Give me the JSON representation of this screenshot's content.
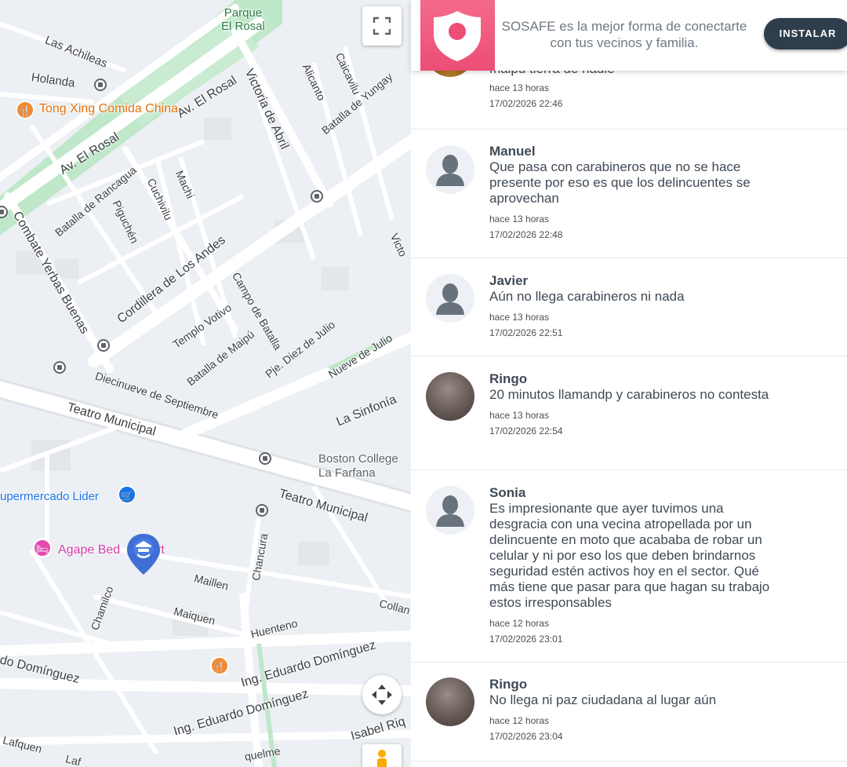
{
  "map": {
    "labels": {
      "parque": "Parque\nEl Rosal",
      "las_achileas": "Las Achileas",
      "holanda": "Holanda",
      "av_el_rosal_1": "Av. El Rosal",
      "av_el_rosal_2": "Av. El Rosal",
      "victoria_de_abril": "Victoria de Abril",
      "alicanto": "Alicanto",
      "caicavilu": "Caicavilu",
      "batalla_de_yungay": "Batalla de Yungay",
      "tong_xing": "Tong Xing Comida China",
      "batalla_de_rancagua": "Batalla de Rancagua",
      "piguchen": "Piguchén",
      "cuchivilu": "Cuchivilu",
      "machi": "Machi",
      "combate_yerbas_buenas": "Combate Yerbas Buenas",
      "cordillera_de_los_andes": "Cordillera de Los Andes",
      "templo_votivo": "Templo Votivo",
      "campo_de_batalla": "Campo de Batalla",
      "batalla_de_maipu": "Batalla de Maipú",
      "pje_diez_de_julio": "Pje. Diez de Julio",
      "nueve_de_julio": "Nueve de Julio",
      "diecinueve_de_septiembre": "Diecinueve de Septiembre",
      "teatro_municipal_1": "Teatro Municipal",
      "la_sinfonia": "La Sinfonía",
      "boston_college": "Boston College\nLa Farfana",
      "supermercado_lider": "upermercado Lider",
      "teatro_municipal_2": "Teatro Municipal",
      "agape": "Agape Bed",
      "agape_suffix": "rt",
      "chancura": "Chancura",
      "maillen": "Maillen",
      "chamilco": "Chamilco",
      "maiquen": "Maiquen",
      "collan": "Collan",
      "huenteno": "Huenteno",
      "do_dominguez": "do Domínguez",
      "ing_eduardo_1": "Ing. Eduardo Domínguez",
      "ing_eduardo_2": "Ing. Eduardo Domínguez",
      "isabel_riq": "Isabel Riq",
      "lafquen": "Lafquen",
      "laf": "Laf",
      "quelme": "quelme",
      "victo": "Victo"
    }
  },
  "banner": {
    "text": "SOSAFE es la mejor forma de conectarte con tus vecinos y familia.",
    "install_label": "INSTALAR"
  },
  "comments": [
    {
      "name": "",
      "text": "maipu tierra de nadie",
      "relative": "hace 13 horas",
      "date": "17/02/2026 22:46"
    },
    {
      "name": "Manuel",
      "text": "Que pasa con carabineros que no se hace presente por eso es que los delincuentes se aprovechan",
      "relative": "hace 13 horas",
      "date": "17/02/2026 22:48"
    },
    {
      "name": "Javier",
      "text": "Aún no llega carabineros ni nada",
      "relative": "hace 13 horas",
      "date": "17/02/2026 22:51"
    },
    {
      "name": "Ringo",
      "text": "20 minutos llamandp y carabineros no contesta",
      "relative": "hace 13 horas",
      "date": "17/02/2026 22:54"
    },
    {
      "name": "Sonia",
      "text": "Es impresionante que ayer tuvimos una desgracia con una vecina atropellada por un delincuente en moto que acababa de robar un celular y ni por eso los que deben brindarnos seguridad estén activos hoy en el sector. Qué más tiene que pasar para que hagan su trabajo estos irresponsables",
      "relative": "hace 12 horas",
      "date": "17/02/2026 23:01"
    },
    {
      "name": "Ringo",
      "text": "No llega ni paz ciudadana al lugar aún",
      "relative": "hace 12 horas",
      "date": "17/02/2026 23:04"
    }
  ]
}
